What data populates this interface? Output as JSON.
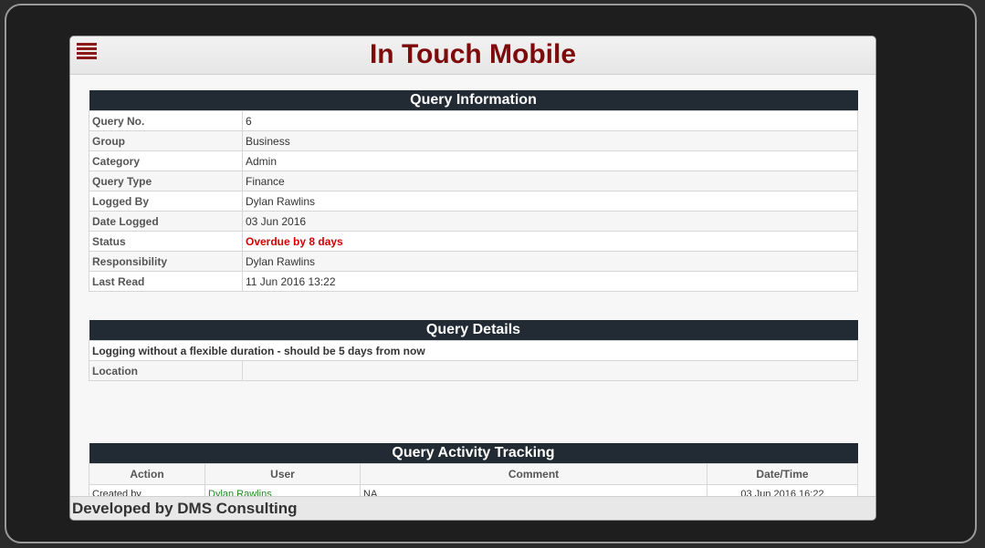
{
  "app": {
    "title": "In Touch Mobile"
  },
  "query_information": {
    "heading": "Query Information",
    "rows": [
      {
        "label": "Query No.",
        "value": "6"
      },
      {
        "label": "Group",
        "value": "Business"
      },
      {
        "label": "Category",
        "value": "Admin"
      },
      {
        "label": "Query Type",
        "value": "Finance"
      },
      {
        "label": "Logged By",
        "value": "Dylan Rawlins"
      },
      {
        "label": "Date Logged",
        "value": "03 Jun 2016"
      },
      {
        "label": "Status",
        "value": "Overdue by 8 days",
        "color": "#d40000"
      },
      {
        "label": "Responsibility",
        "value": "Dylan Rawlins"
      },
      {
        "label": "Last Read",
        "value": "11 Jun 2016 13:22"
      }
    ]
  },
  "query_details": {
    "heading": "Query Details",
    "description": "Logging without a flexible duration - should be 5 days from now",
    "location_label": "Location",
    "location_value": ""
  },
  "activity": {
    "heading": "Query Activity Tracking",
    "columns": [
      "Action",
      "User",
      "Comment",
      "Date/Time"
    ],
    "rows": [
      {
        "action": "Created by",
        "user": "Dylan Rawlins",
        "comment": "NA",
        "datetime": "03 Jun 2016 16:22"
      }
    ]
  },
  "footer": {
    "text": "Developed by DMS Consulting"
  },
  "colors": {
    "title": "#7d0b0b",
    "header_bar": "#222a33",
    "status_overdue": "#d40000",
    "user_link": "#1f8a1f"
  }
}
